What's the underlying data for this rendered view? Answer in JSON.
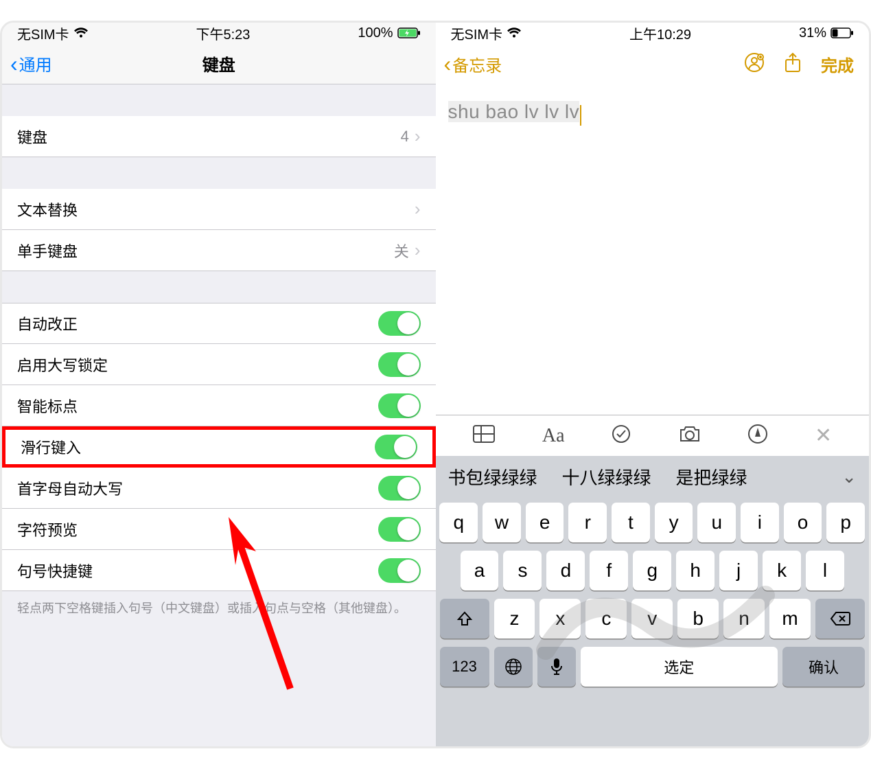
{
  "left": {
    "status": {
      "carrier": "无SIM卡",
      "time": "下午5:23",
      "battery": "100%"
    },
    "nav": {
      "back": "通用",
      "title": "键盘"
    },
    "cells": {
      "keyboards": {
        "label": "键盘",
        "value": "4"
      },
      "text_replace": {
        "label": "文本替换"
      },
      "one_hand": {
        "label": "单手键盘",
        "value": "关"
      }
    },
    "toggles": [
      {
        "label": "自动改正"
      },
      {
        "label": "启用大写锁定"
      },
      {
        "label": "智能标点"
      },
      {
        "label": "滑行键入",
        "highlight": true
      },
      {
        "label": "首字母自动大写"
      },
      {
        "label": "字符预览"
      },
      {
        "label": "句号快捷键"
      }
    ],
    "footer": "轻点两下空格键插入句号（中文键盘）或插入句点与空格（其他键盘）。"
  },
  "right": {
    "status": {
      "carrier": "无SIM卡",
      "time": "上午10:29",
      "battery": "31%"
    },
    "nav": {
      "back": "备忘录",
      "done": "完成"
    },
    "note_text": "shu bao lv lv lv",
    "candidates": [
      "书包绿绿绿",
      "十八绿绿绿",
      "是把绿绿"
    ],
    "keys": {
      "row1": [
        "q",
        "w",
        "e",
        "r",
        "t",
        "y",
        "u",
        "i",
        "o",
        "p"
      ],
      "row2": [
        "a",
        "s",
        "d",
        "f",
        "g",
        "h",
        "j",
        "k",
        "l"
      ],
      "row3": [
        "z",
        "x",
        "c",
        "v",
        "b",
        "n",
        "m"
      ],
      "num": "123",
      "space": "选定",
      "confirm": "确认"
    }
  }
}
